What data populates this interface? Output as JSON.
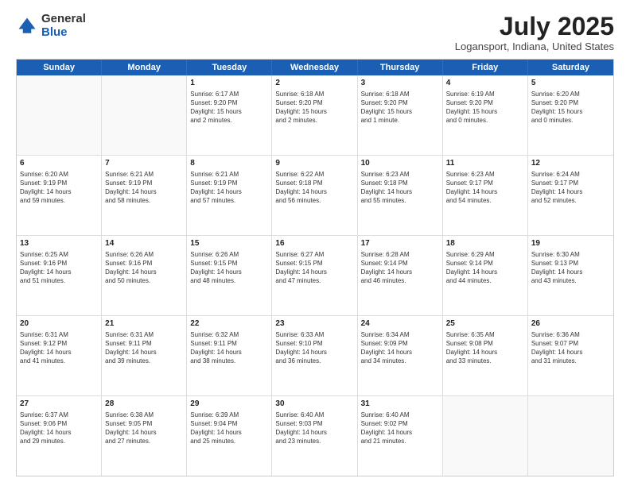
{
  "header": {
    "logo_general": "General",
    "logo_blue": "Blue",
    "month_title": "July 2025",
    "location": "Logansport, Indiana, United States"
  },
  "days_of_week": [
    "Sunday",
    "Monday",
    "Tuesday",
    "Wednesday",
    "Thursday",
    "Friday",
    "Saturday"
  ],
  "weeks": [
    [
      {
        "day": "",
        "info": ""
      },
      {
        "day": "",
        "info": ""
      },
      {
        "day": "1",
        "info": "Sunrise: 6:17 AM\nSunset: 9:20 PM\nDaylight: 15 hours\nand 2 minutes."
      },
      {
        "day": "2",
        "info": "Sunrise: 6:18 AM\nSunset: 9:20 PM\nDaylight: 15 hours\nand 2 minutes."
      },
      {
        "day": "3",
        "info": "Sunrise: 6:18 AM\nSunset: 9:20 PM\nDaylight: 15 hours\nand 1 minute."
      },
      {
        "day": "4",
        "info": "Sunrise: 6:19 AM\nSunset: 9:20 PM\nDaylight: 15 hours\nand 0 minutes."
      },
      {
        "day": "5",
        "info": "Sunrise: 6:20 AM\nSunset: 9:20 PM\nDaylight: 15 hours\nand 0 minutes."
      }
    ],
    [
      {
        "day": "6",
        "info": "Sunrise: 6:20 AM\nSunset: 9:19 PM\nDaylight: 14 hours\nand 59 minutes."
      },
      {
        "day": "7",
        "info": "Sunrise: 6:21 AM\nSunset: 9:19 PM\nDaylight: 14 hours\nand 58 minutes."
      },
      {
        "day": "8",
        "info": "Sunrise: 6:21 AM\nSunset: 9:19 PM\nDaylight: 14 hours\nand 57 minutes."
      },
      {
        "day": "9",
        "info": "Sunrise: 6:22 AM\nSunset: 9:18 PM\nDaylight: 14 hours\nand 56 minutes."
      },
      {
        "day": "10",
        "info": "Sunrise: 6:23 AM\nSunset: 9:18 PM\nDaylight: 14 hours\nand 55 minutes."
      },
      {
        "day": "11",
        "info": "Sunrise: 6:23 AM\nSunset: 9:17 PM\nDaylight: 14 hours\nand 54 minutes."
      },
      {
        "day": "12",
        "info": "Sunrise: 6:24 AM\nSunset: 9:17 PM\nDaylight: 14 hours\nand 52 minutes."
      }
    ],
    [
      {
        "day": "13",
        "info": "Sunrise: 6:25 AM\nSunset: 9:16 PM\nDaylight: 14 hours\nand 51 minutes."
      },
      {
        "day": "14",
        "info": "Sunrise: 6:26 AM\nSunset: 9:16 PM\nDaylight: 14 hours\nand 50 minutes."
      },
      {
        "day": "15",
        "info": "Sunrise: 6:26 AM\nSunset: 9:15 PM\nDaylight: 14 hours\nand 48 minutes."
      },
      {
        "day": "16",
        "info": "Sunrise: 6:27 AM\nSunset: 9:15 PM\nDaylight: 14 hours\nand 47 minutes."
      },
      {
        "day": "17",
        "info": "Sunrise: 6:28 AM\nSunset: 9:14 PM\nDaylight: 14 hours\nand 46 minutes."
      },
      {
        "day": "18",
        "info": "Sunrise: 6:29 AM\nSunset: 9:14 PM\nDaylight: 14 hours\nand 44 minutes."
      },
      {
        "day": "19",
        "info": "Sunrise: 6:30 AM\nSunset: 9:13 PM\nDaylight: 14 hours\nand 43 minutes."
      }
    ],
    [
      {
        "day": "20",
        "info": "Sunrise: 6:31 AM\nSunset: 9:12 PM\nDaylight: 14 hours\nand 41 minutes."
      },
      {
        "day": "21",
        "info": "Sunrise: 6:31 AM\nSunset: 9:11 PM\nDaylight: 14 hours\nand 39 minutes."
      },
      {
        "day": "22",
        "info": "Sunrise: 6:32 AM\nSunset: 9:11 PM\nDaylight: 14 hours\nand 38 minutes."
      },
      {
        "day": "23",
        "info": "Sunrise: 6:33 AM\nSunset: 9:10 PM\nDaylight: 14 hours\nand 36 minutes."
      },
      {
        "day": "24",
        "info": "Sunrise: 6:34 AM\nSunset: 9:09 PM\nDaylight: 14 hours\nand 34 minutes."
      },
      {
        "day": "25",
        "info": "Sunrise: 6:35 AM\nSunset: 9:08 PM\nDaylight: 14 hours\nand 33 minutes."
      },
      {
        "day": "26",
        "info": "Sunrise: 6:36 AM\nSunset: 9:07 PM\nDaylight: 14 hours\nand 31 minutes."
      }
    ],
    [
      {
        "day": "27",
        "info": "Sunrise: 6:37 AM\nSunset: 9:06 PM\nDaylight: 14 hours\nand 29 minutes."
      },
      {
        "day": "28",
        "info": "Sunrise: 6:38 AM\nSunset: 9:05 PM\nDaylight: 14 hours\nand 27 minutes."
      },
      {
        "day": "29",
        "info": "Sunrise: 6:39 AM\nSunset: 9:04 PM\nDaylight: 14 hours\nand 25 minutes."
      },
      {
        "day": "30",
        "info": "Sunrise: 6:40 AM\nSunset: 9:03 PM\nDaylight: 14 hours\nand 23 minutes."
      },
      {
        "day": "31",
        "info": "Sunrise: 6:40 AM\nSunset: 9:02 PM\nDaylight: 14 hours\nand 21 minutes."
      },
      {
        "day": "",
        "info": ""
      },
      {
        "day": "",
        "info": ""
      }
    ]
  ]
}
